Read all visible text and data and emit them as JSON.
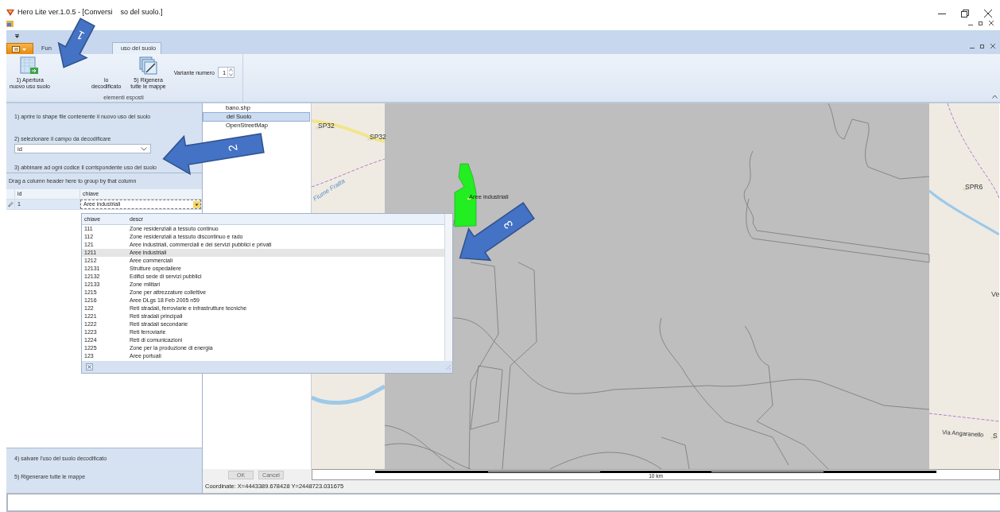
{
  "window": {
    "title_parts": [
      "Hero Lite ver.1.0.5 - [Conversi",
      "so del suolo.]"
    ]
  },
  "ribbon": {
    "tabs": [
      {
        "label": "Fun",
        "selected": false
      },
      {
        "label": "uso del suolo",
        "selected": true
      }
    ],
    "buttons": [
      {
        "kind": "open",
        "lines": [
          "1) Apertura",
          "nuovo uso suolo"
        ]
      },
      {
        "kind": "hidden",
        "lines": [
          "lo",
          "decodificato"
        ]
      },
      {
        "kind": "regen",
        "lines": [
          "5) Rigenera",
          "tutte le mappe"
        ]
      }
    ],
    "variant": {
      "label": "Variante numero",
      "value": "1"
    },
    "group_label": "elementi esposti"
  },
  "steps_top": [
    "1) aprire lo shape file contenente il nuovo uso del suolo",
    "2) selezionare il campo da decodificare"
  ],
  "field_combo": {
    "value": "id"
  },
  "step3": "3) abbinare ad ogni codice il corrispondente uso del suolo",
  "grid": {
    "group_hint": "Drag a column header here to group by that column",
    "columns": [
      "id",
      "chiave"
    ],
    "rows": [
      {
        "id": "1",
        "chiave": "Aree industriali",
        "editing": true
      }
    ]
  },
  "dropdown": {
    "columns": [
      "chiave",
      "descr"
    ],
    "rows": [
      {
        "chiave": "111",
        "descr": "Zone residenziali a tessuto continuo",
        "selected": false
      },
      {
        "chiave": "112",
        "descr": "Zone residenziali a tessuto discontinuo e rado",
        "selected": false
      },
      {
        "chiave": "121",
        "descr": "Aree industriali, commerciali e dei servizi pubblici e privati",
        "selected": false
      },
      {
        "chiave": "1211",
        "descr": "Aree industriali",
        "selected": true
      },
      {
        "chiave": "1212",
        "descr": "Aree commerciali",
        "selected": false
      },
      {
        "chiave": "12131",
        "descr": "Strutture ospedaliere",
        "selected": false
      },
      {
        "chiave": "12132",
        "descr": "Edifici sede di servizi pubblici",
        "selected": false
      },
      {
        "chiave": "12133",
        "descr": "Zone militari",
        "selected": false
      },
      {
        "chiave": "1215",
        "descr": "Zone per attrezzature collettive",
        "selected": false
      },
      {
        "chiave": "1216",
        "descr": "Aree DLgs 18 Feb 2005 n59",
        "selected": false
      },
      {
        "chiave": "122",
        "descr": "Reti stradali, ferroviarie e infrastrutture tecniche",
        "selected": false
      },
      {
        "chiave": "1221",
        "descr": "Reti stradali principali",
        "selected": false
      },
      {
        "chiave": "1222",
        "descr": "Reti stradali secondarie",
        "selected": false
      },
      {
        "chiave": "1223",
        "descr": "Reti ferroviarie",
        "selected": false
      },
      {
        "chiave": "1224",
        "descr": "Reti di comunicazioni",
        "selected": false
      },
      {
        "chiave": "1225",
        "descr": "Zone per la produzione di energia",
        "selected": false
      },
      {
        "chiave": "123",
        "descr": "Aree portuali",
        "selected": false
      }
    ]
  },
  "steps_bottom": [
    "4) salvare l'uso del suolo decodificato",
    "5) Rigenerare tutte le mappe"
  ],
  "layers": [
    {
      "label": "bano.shp",
      "selected": false
    },
    {
      "label": "del Suolo",
      "selected": true
    },
    {
      "label": "OpenStreetMap",
      "selected": false
    }
  ],
  "dialog_buttons": [
    {
      "label": "OK",
      "disabled": true
    },
    {
      "label": "Cancel",
      "disabled": true
    }
  ],
  "coordinates": "Coordinate: X=4443389.678428 Y=2448723.031675",
  "map": {
    "labels": [
      {
        "kind": "road",
        "text": "SP32"
      },
      {
        "kind": "road",
        "text": "SP32"
      },
      {
        "kind": "water",
        "text": "Fiume Fratta"
      },
      {
        "kind": "area",
        "text": "Aree industriali"
      },
      {
        "kind": "road",
        "text": "SPR6"
      },
      {
        "kind": "place",
        "text": "Ve"
      },
      {
        "kind": "street",
        "text": "Via Angaranello"
      },
      {
        "kind": "road",
        "text": "S"
      }
    ],
    "scale": "10 km"
  },
  "callouts": [
    "1",
    "2",
    "3"
  ]
}
